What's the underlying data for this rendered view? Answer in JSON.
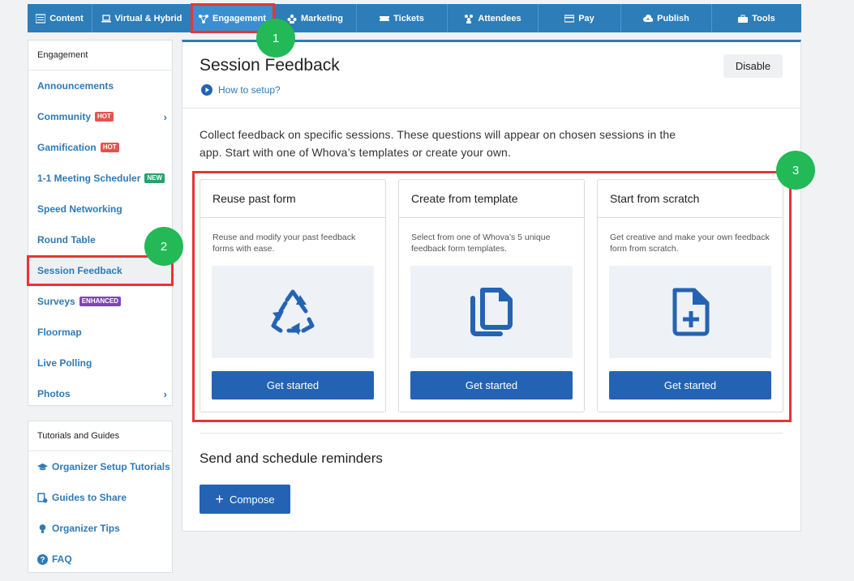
{
  "nav": {
    "tabs": [
      {
        "label": "Content",
        "icon": "list-icon"
      },
      {
        "label": "Virtual & Hybrid",
        "icon": "laptop-icon"
      },
      {
        "label": "Engagement",
        "icon": "network-icon",
        "active": true
      },
      {
        "label": "Marketing",
        "icon": "users-icon"
      },
      {
        "label": "Tickets",
        "icon": "ticket-icon"
      },
      {
        "label": "Attendees",
        "icon": "group-icon"
      },
      {
        "label": "Pay",
        "icon": "card-icon"
      },
      {
        "label": "Publish",
        "icon": "cloud-upload-icon"
      },
      {
        "label": "Tools",
        "icon": "toolbox-icon"
      }
    ]
  },
  "sidebar": {
    "heading": "Engagement",
    "items": [
      {
        "label": "Announcements"
      },
      {
        "label": "Community",
        "badge": "HOT",
        "chevron": "›"
      },
      {
        "label": "Gamification",
        "badge": "HOT"
      },
      {
        "label": "1-1 Meeting Scheduler",
        "badge": "NEW"
      },
      {
        "label": "Speed Networking"
      },
      {
        "label": "Round Table"
      },
      {
        "label": "Session Feedback",
        "active": true
      },
      {
        "label": "Surveys",
        "badge": "ENHANCED"
      },
      {
        "label": "Floormap"
      },
      {
        "label": "Live Polling"
      },
      {
        "label": "Photos",
        "chevron": "›"
      }
    ]
  },
  "guides": {
    "heading": "Tutorials and Guides",
    "items": [
      {
        "label": "Organizer Setup Tutorials",
        "icon": "graduation-cap-icon"
      },
      {
        "label": "Guides to Share",
        "icon": "share-icon"
      },
      {
        "label": "Organizer Tips",
        "icon": "lightbulb-icon"
      },
      {
        "label": "FAQ",
        "icon": "question-icon"
      }
    ]
  },
  "main": {
    "title": "Session Feedback",
    "howto": "How to setup?",
    "disable": "Disable",
    "intro": "Collect feedback on specific sessions. These questions will appear on chosen sessions in the app. Start with one of Whova’s templates or create your own.",
    "cards": [
      {
        "title": "Reuse past form",
        "desc": "Reuse and modify your past feedback forms with ease.",
        "icon": "recycle-icon",
        "button": "Get started"
      },
      {
        "title": "Create from template",
        "desc": "Select from one of Whova’s 5 unique feedback form templates.",
        "icon": "copy-icon",
        "button": "Get started"
      },
      {
        "title": "Start from scratch",
        "desc": "Get creative and make your own feedback form from scratch.",
        "icon": "file-plus-icon",
        "button": "Get started"
      }
    ],
    "reminders_title": "Send and schedule reminders",
    "compose": "Compose",
    "compose_icon": "+"
  },
  "steps": [
    "1",
    "2",
    "3"
  ],
  "colors": {
    "nav": "#2c7db8",
    "accent": "#2463b4",
    "highlight": "#e8333a",
    "step": "#22b956",
    "link": "#2f7ab7"
  }
}
